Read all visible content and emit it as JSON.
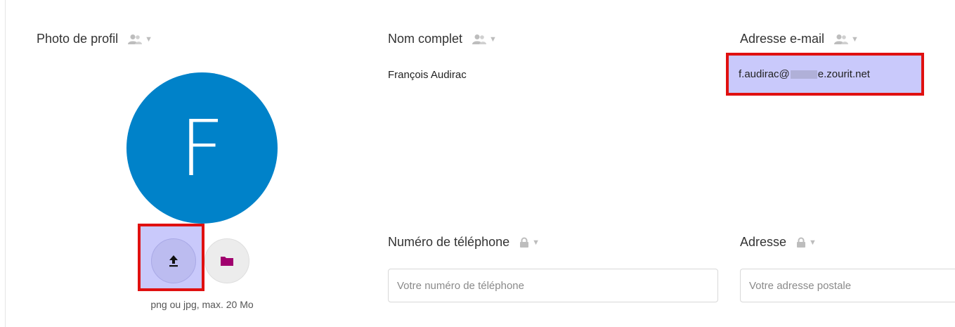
{
  "profile_photo": {
    "title": "Photo de profil",
    "initial": "F",
    "hint": "png ou jpg, max. 20 Mo",
    "upload_icon": "upload-icon",
    "folder_icon": "folder-icon",
    "colors": {
      "avatar": "#0082c9",
      "folder": "#a0006e",
      "highlight": "#c9c9fb",
      "highlight_border": "#e01010"
    }
  },
  "full_name": {
    "title": "Nom complet",
    "value": "François Audirac"
  },
  "email": {
    "title": "Adresse e-mail",
    "value_start": "f.audirac@",
    "value_end": "e.zourit.net"
  },
  "phone": {
    "title": "Numéro de téléphone",
    "placeholder": "Votre numéro de téléphone"
  },
  "address": {
    "title": "Adresse",
    "placeholder": "Votre adresse postale"
  }
}
